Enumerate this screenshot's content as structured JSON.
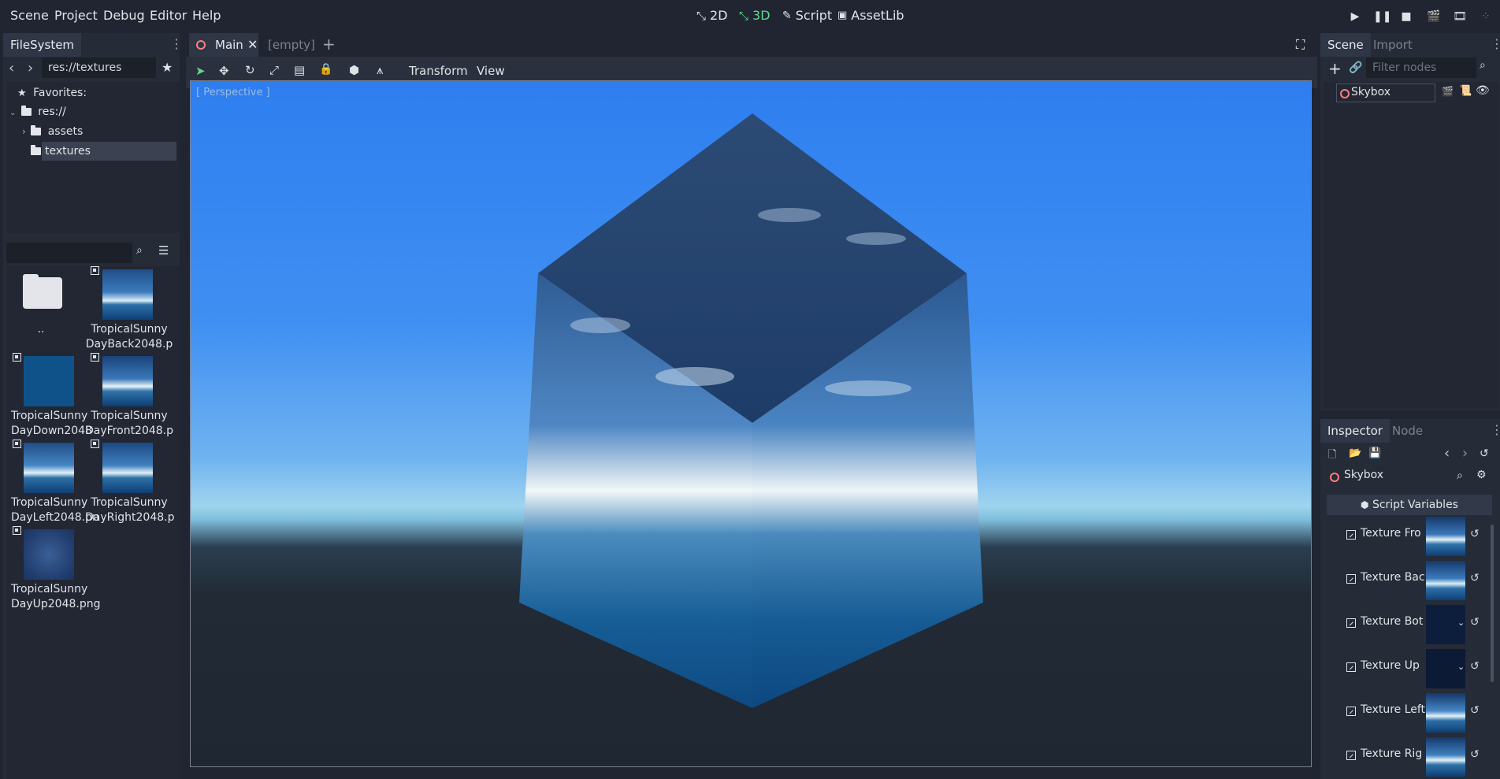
{
  "menu": {
    "scene": "Scene",
    "project": "Project",
    "debug": "Debug",
    "editor": "Editor",
    "help": "Help"
  },
  "modes": {
    "m2d": "2D",
    "m3d": "3D",
    "script": "Script",
    "assetlib": "AssetLib"
  },
  "filesystem": {
    "tab": "FileSystem",
    "path": "res://textures",
    "favorites": "Favorites:",
    "tree": {
      "root": "res://",
      "assets": "assets",
      "textures": "textures"
    },
    "files": [
      {
        "name": ".."
      },
      {
        "name": "TropicalSunny\nDayBack2048.p"
      },
      {
        "name": "TropicalSunny\nDayDown2048"
      },
      {
        "name": "TropicalSunny\nDayFront2048.p"
      },
      {
        "name": "TropicalSunny\nDayLeft2048.pn"
      },
      {
        "name": "TropicalSunny\nDayRight2048.p"
      },
      {
        "name": "TropicalSunny\nDayUp2048.png"
      }
    ]
  },
  "editor": {
    "tab_main": "Main",
    "tab_empty": "[empty]",
    "transform": "Transform",
    "view": "View",
    "perspective": "[ Perspective ]"
  },
  "scene_dock": {
    "tab_scene": "Scene",
    "tab_import": "Import",
    "filter_placeholder": "Filter nodes",
    "node": "Skybox"
  },
  "inspector": {
    "tab_inspector": "Inspector",
    "tab_node": "Node",
    "object": "Skybox",
    "section": "Script Variables",
    "props": [
      {
        "label": "Texture Fro"
      },
      {
        "label": "Texture Bac"
      },
      {
        "label": "Texture Bot"
      },
      {
        "label": "Texture Up"
      },
      {
        "label": "Texture Left"
      },
      {
        "label": "Texture Rig"
      }
    ]
  },
  "colors": {
    "accent_green": "#62d98e",
    "bg": "#202531",
    "panel": "#252b37",
    "node_ring": "#fc7f7f"
  }
}
